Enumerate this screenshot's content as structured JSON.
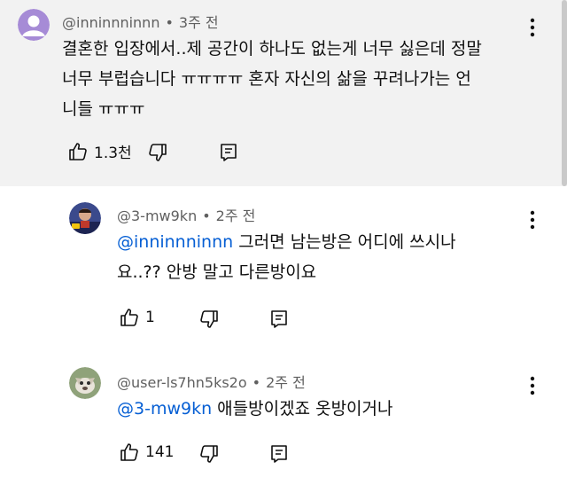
{
  "comments": [
    {
      "author": "@inninnninnn",
      "time": "3주 전",
      "lines": [
        "결혼한 입장에서..제 공간이 하나도 없는게 너무 싫은데 정말",
        "너무 부럽습니다 ㅠㅠㅠㅠ 혼자 자신의 삶을 꾸려나가는 언",
        "니들 ㅠㅠㅠ"
      ],
      "likes": "1.3천"
    },
    {
      "author": "@3-mw9kn",
      "time": "2주 전",
      "mention": "@inninnninnn",
      "lines": [
        " 그러면 남는방은 어디에 쓰시나",
        "요..?? 안방 말고 다른방이요"
      ],
      "likes": "1"
    },
    {
      "author": "@user-ls7hn5ks2o",
      "time": "2주 전",
      "mention": "@3-mw9kn",
      "lines": [
        " 애들방이겠죠 옷방이거나"
      ],
      "likes": "141"
    }
  ],
  "separator": "•",
  "icons": {
    "like": "thumbs-up-icon",
    "dislike": "thumbs-down-icon",
    "reply": "reply-icon",
    "more": "more-vert-icon"
  },
  "colors": {
    "mention": "#065fd4",
    "highlight_bg": "#f2f2f2",
    "meta": "#606060"
  }
}
